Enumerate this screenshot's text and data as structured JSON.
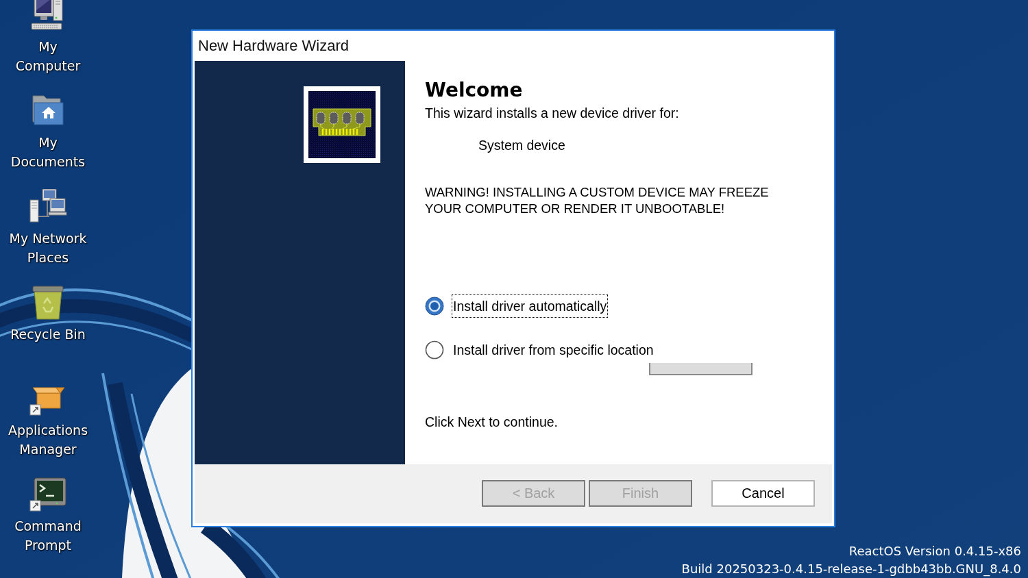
{
  "desktop": {
    "icons": [
      {
        "kind": "computer",
        "label": "My Computer",
        "shortcut": false
      },
      {
        "kind": "documents",
        "label": "My Documents",
        "shortcut": false
      },
      {
        "kind": "network",
        "label": "My Network Places",
        "shortcut": false
      },
      {
        "kind": "recycle_bin",
        "label": "Recycle Bin",
        "shortcut": false
      },
      {
        "kind": "app_manager",
        "label": "Applications Manager",
        "shortcut": true
      },
      {
        "kind": "terminal",
        "label": "Command Prompt",
        "shortcut": true
      }
    ],
    "version_lines": [
      "ReactOS Version 0.4.15-x86",
      "Build 20250323-0.4.15-release-1-gdbb43bb.GNU_8.4.0"
    ]
  },
  "window": {
    "title": "New Hardware Wizard",
    "heading": "Welcome",
    "intro": "This wizard installs a new device driver for:",
    "device": "System device",
    "warning": "WARNING! INSTALLING A CUSTOM DEVICE MAY FREEZE YOUR COMPUTER OR RENDER IT UNBOOTABLE!",
    "options": [
      {
        "label": "Install driver automatically",
        "selected": true,
        "focused": true
      },
      {
        "label": "Install driver from specific location",
        "selected": false,
        "focused": false
      }
    ],
    "help_button": {
      "disabled": true
    },
    "hint": "Click Next to continue.",
    "buttons": [
      {
        "label": "< Back",
        "disabled": true
      },
      {
        "label": "Finish",
        "disabled": true
      },
      {
        "label": "Cancel",
        "disabled": false
      }
    ]
  }
}
